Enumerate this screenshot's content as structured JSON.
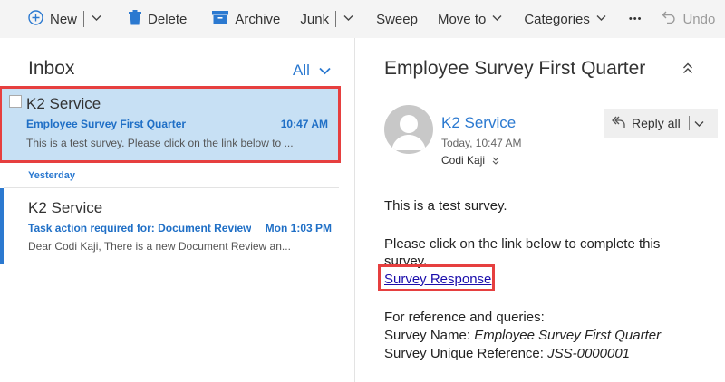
{
  "toolbar": {
    "new_label": "New",
    "delete_label": "Delete",
    "archive_label": "Archive",
    "junk_label": "Junk",
    "sweep_label": "Sweep",
    "move_to_label": "Move to",
    "categories_label": "Categories",
    "more_label": "•••",
    "undo_label": "Undo"
  },
  "list": {
    "title": "Inbox",
    "filter_label": "All",
    "group_yesterday": "Yesterday",
    "messages": [
      {
        "sender": "K2 Service",
        "subject": "Employee Survey First Quarter",
        "time": "10:47 AM",
        "preview": "This is a test survey.  Please click on the link below to ..."
      },
      {
        "sender": "K2 Service",
        "subject": "Task action required for: Document Review a",
        "time": "Mon 1:03 PM",
        "preview": "Dear Codi Kaji,  There is a new Document Review an..."
      }
    ]
  },
  "reading": {
    "title": "Employee Survey First Quarter",
    "from": "K2 Service",
    "date": "Today, 10:47 AM",
    "to": "Codi Kaji",
    "reply_all_label": "Reply all",
    "body_line1": "This is a test survey.",
    "body_line2": "Please click on the link below to complete this survey.",
    "link_text": "Survey Response",
    "ref_line": "For reference and queries:",
    "survey_name_label": "Survey Name: ",
    "survey_name_value": "Employee Survey First Quarter",
    "survey_ref_label": "Survey Unique Reference: ",
    "survey_ref_value": "JSS-0000001"
  },
  "colors": {
    "accent": "#2b79d0",
    "selected_bg": "#c7e0f4",
    "highlight_box": "#e63f3f",
    "toolbar_bg": "#f4f4f4"
  }
}
